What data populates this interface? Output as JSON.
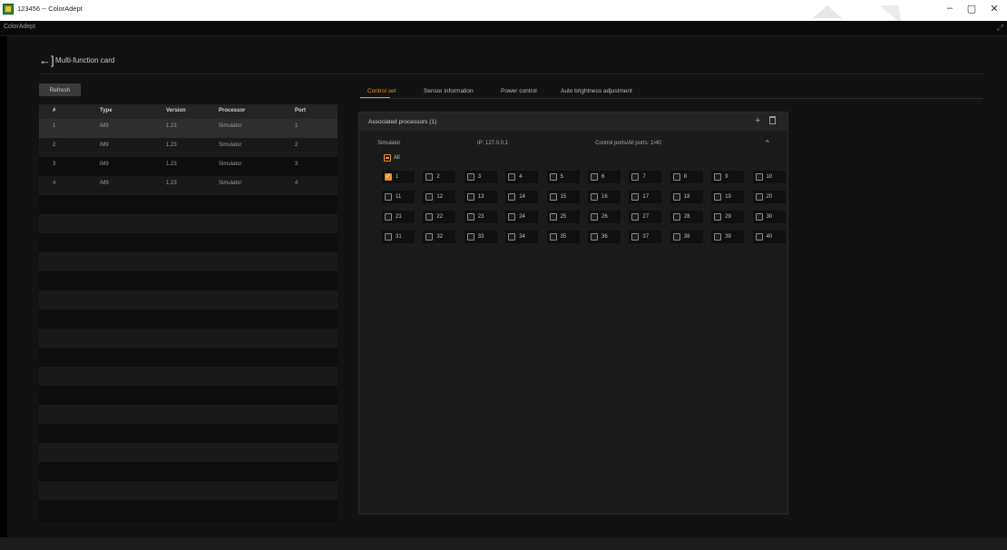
{
  "window": {
    "title": "123456 -- ColorAdept",
    "app_name": "ColorAdept",
    "minimize": "–",
    "maximize": "▢",
    "close": "✕",
    "expand": "⤢"
  },
  "page": {
    "back_icon": "←]",
    "title": "Multi-function card",
    "refresh_label": "Refresh"
  },
  "table": {
    "columns": [
      "#",
      "Type",
      "Version",
      "Processor",
      "Port"
    ],
    "rows": [
      [
        "1",
        "iM9",
        "1.23",
        "Simulator",
        "1"
      ],
      [
        "2",
        "iM9",
        "1.23",
        "Simulator",
        "2"
      ],
      [
        "3",
        "iM9",
        "1.23",
        "Simulator",
        "3"
      ],
      [
        "4",
        "iM9",
        "1.23",
        "Simulator",
        "4"
      ]
    ],
    "selected_row": 0
  },
  "tabs": [
    "Control set",
    "Sensor information",
    "Power control",
    "Auto brightness adjustment"
  ],
  "active_tab": 0,
  "panel": {
    "header": "Associated processors (1)",
    "plus": "+",
    "processor": {
      "name": "Simulator",
      "ip": "IP: 127.0.0.1",
      "ports_info": "Control ports/All ports: 1/40",
      "collapse": "^"
    },
    "all_label": "All",
    "ports": [
      "1",
      "2",
      "3",
      "4",
      "5",
      "6",
      "7",
      "8",
      "9",
      "10",
      "11",
      "12",
      "13",
      "14",
      "15",
      "16",
      "17",
      "18",
      "19",
      "20",
      "21",
      "22",
      "23",
      "24",
      "25",
      "26",
      "27",
      "28",
      "29",
      "30",
      "31",
      "32",
      "33",
      "34",
      "35",
      "36",
      "37",
      "38",
      "39",
      "40"
    ],
    "checked_ports": [
      "1"
    ]
  },
  "colors": {
    "accent": "#e8912a",
    "background": "#121212"
  }
}
